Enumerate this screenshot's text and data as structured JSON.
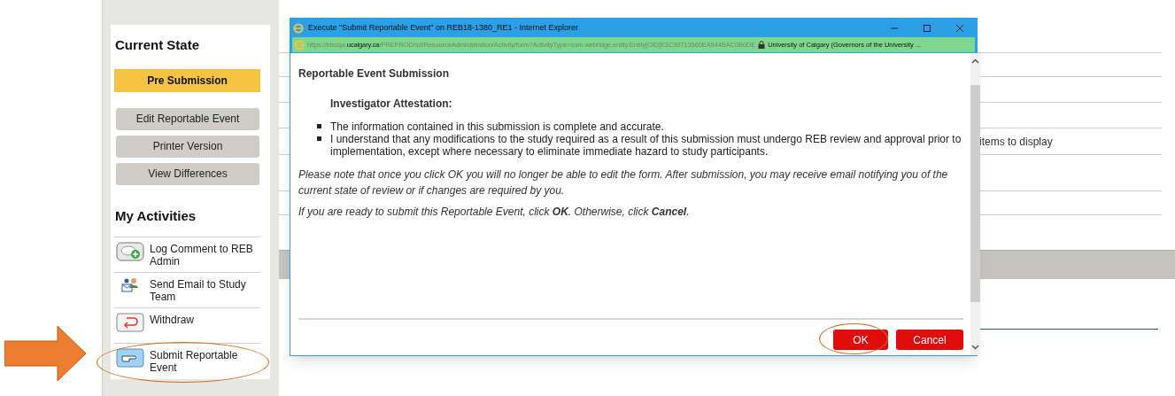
{
  "sidebar": {
    "current_state_title": "Current State",
    "state": "Pre Submission",
    "actions": [
      "Edit Reportable Event",
      "Printer Version",
      "View Differences"
    ],
    "activities_title": "My Activities",
    "activities": [
      {
        "label": "Log Comment to REB Admin",
        "kind": "comment",
        "highlighted": false
      },
      {
        "label": "Send Email to Study Team",
        "kind": "people",
        "highlighted": false
      },
      {
        "label": "Withdraw",
        "kind": "withdraw",
        "highlighted": false
      },
      {
        "label": "Submit Reportable Event",
        "kind": "pointer",
        "highlighted": true
      }
    ]
  },
  "background": {
    "list_text": "items to display"
  },
  "dialog": {
    "title": "Execute \"Submit Reportable Event\" on REB18-1380_RE1 - Internet Explorer",
    "url": "https://irissqa.**ucalgary.ca**/PREPROD/sd/ResourceAdministration/Activity/form?ActivityType=com.webridge.entity.Entity[OID[E3C90713560EA944BAC0B0DE",
    "certificate": "University of Calgary (Governors of the University ...",
    "heading": "Reportable Event Submission",
    "section_heading": "Investigator Attestation:",
    "bullets": [
      "The information contained in this submission is complete and accurate.",
      "I understand that any modifications to the study required as a result of this submission must undergo REB review and approval prior to implementation, except where necessary to eliminate immediate hazard to study participants."
    ],
    "notes": [
      "Please note that once you click OK you will no longer be able to edit the form.  After submission, you may receive email notifying you of the current state of review or if changes are required by you.",
      "If you are ready to submit this Reportable Event, click **OK**.  Otherwise, click **Cancel**."
    ],
    "buttons": [
      {
        "label": "OK",
        "highlighted": true
      },
      {
        "label": "Cancel",
        "highlighted": false
      }
    ]
  }
}
